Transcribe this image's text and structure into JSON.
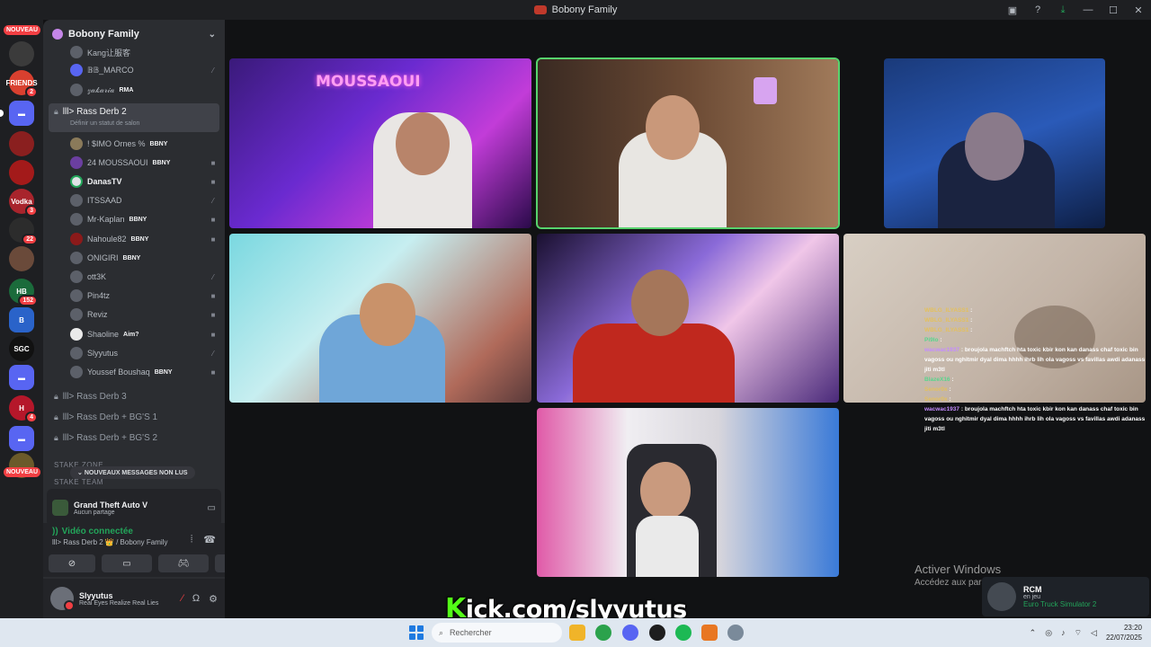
{
  "window": {
    "title": "Bobony Family"
  },
  "rail": {
    "new_label_top": "NOUVEAU",
    "new_label_bottom": "NOUVEAU",
    "servers": [
      {
        "name": "friends-server",
        "label": "FRIENDS",
        "badge": "2",
        "color": "#d9402f"
      },
      {
        "name": "server-3",
        "label": "Vodka",
        "badge": "3",
        "color": "#a8242c"
      },
      {
        "name": "server-22",
        "label": "",
        "badge": "22",
        "color": "#2c2c2c"
      },
      {
        "name": "server-152",
        "label": "HB",
        "badge": "152",
        "color": "#1b6b3b"
      },
      {
        "name": "server-b",
        "label": "B",
        "badge": "",
        "color": "#2a63c9"
      },
      {
        "name": "server-sgc",
        "label": "SGC",
        "badge": "",
        "color": "#111111"
      },
      {
        "name": "server-4",
        "label": "H",
        "badge": "4",
        "color": "#b5172a"
      }
    ]
  },
  "panel": {
    "guild_name": "Bobony Family",
    "voice_users_top": [
      {
        "name": "Kang让服客",
        "tag": ""
      },
      {
        "name": "𝔹𝔹_MARCO",
        "tag": ""
      },
      {
        "name": "𝓏𝒶𝓀𝒶𝓇𝒾𝒶",
        "tag": "RMA"
      }
    ],
    "active_channel": {
      "name": "lll> Rass Derb 2",
      "status": "Définir un statut de salon"
    },
    "members": [
      {
        "name": "! $IMO Ornes %",
        "tag": "BBNY",
        "bold": false
      },
      {
        "name": "24 MOUSSAOUI",
        "tag": "BBNY",
        "bold": false
      },
      {
        "name": "DanasTV",
        "tag": "",
        "bold": true
      },
      {
        "name": "ITSSAAD",
        "tag": "",
        "bold": false
      },
      {
        "name": "Mr-Kaplan",
        "tag": "BBNY",
        "bold": false
      },
      {
        "name": "Nahoule82",
        "tag": "BBNY",
        "bold": false
      },
      {
        "name": "ONIGIRI",
        "tag": "BBNY",
        "bold": false
      },
      {
        "name": "ott3K",
        "tag": "",
        "bold": false
      },
      {
        "name": "Pin4tz",
        "tag": "",
        "bold": false
      },
      {
        "name": "Reviz",
        "tag": "",
        "bold": false
      },
      {
        "name": "Shaoline",
        "tag": "Aim?",
        "bold": false
      },
      {
        "name": "Slyyutus",
        "tag": "",
        "bold": false
      },
      {
        "name": "Youssef Boushaq",
        "tag": "BBNY",
        "bold": false
      }
    ],
    "channels": [
      {
        "name": "lll> Rass Derb 3"
      },
      {
        "name": "lll> Rass Derb + BG'S 1"
      },
      {
        "name": "lll> Rass Derb + BG'S 2"
      }
    ],
    "category": "STAKE ZONE",
    "category2": "STAKE TEAM",
    "new_messages": "NOUVEAUX MESSAGES NON LUS",
    "game": {
      "title": "Grand Theft Auto V",
      "subtitle": "Aucun partage"
    },
    "voice": {
      "status": "Vidéo connectée",
      "location": "lll> Rass Derb 2 👑 / Bobony Family"
    },
    "user": {
      "name": "Slyyutus",
      "status": "Real Eyes Realize Real Lies"
    }
  },
  "stage": {
    "neon_sign": "MOUSSAOUI",
    "chat": [
      {
        "user": "WBLG_ILYASS1",
        "msg": "",
        "cls": "y"
      },
      {
        "user": "WBLG_ILYASS1",
        "msg": "",
        "cls": "y"
      },
      {
        "user": "WBLG_ILYASS1",
        "msg": "",
        "cls": "y"
      },
      {
        "user": "Pi9lo",
        "msg": "",
        "cls": "g"
      },
      {
        "user": "wacwac1937",
        "msg": "broujola machftch hta toxic kbir kon kan danass chaf toxic bin vagoss ou nghitmir dyal dima hhhh ihrb lih ola vagoss vs favillas awdi adanass jiti m3tl",
        "cls": "p"
      },
      {
        "user": "BlazeX16",
        "msg": "",
        "cls": "g"
      },
      {
        "user": "Senor0x",
        "msg": "",
        "cls": "y"
      },
      {
        "user": "Senor0x",
        "msg": "",
        "cls": "y"
      },
      {
        "user": "wacwac1937",
        "msg": "broujola machftch hta toxic kbir kon kan danass chaf toxic bin vagoss ou nghitmir dyal dima hhhh ihrb lih ola vagoss vs favillas awdi adanass jiti m3tl",
        "cls": "p"
      }
    ],
    "activate_title": "Activer Windows",
    "activate_sub": "Accédez aux paramètres pour activer Windows.",
    "kick_k": "K",
    "kick_rest": "ick.com/slyyutus",
    "toast": {
      "name": "RCM",
      "state": "en jeu",
      "game": "Euro Truck Simulator 2"
    }
  },
  "taskbar": {
    "search_placeholder": "Rechercher",
    "time": "23:20",
    "date": "22/07/2025"
  }
}
